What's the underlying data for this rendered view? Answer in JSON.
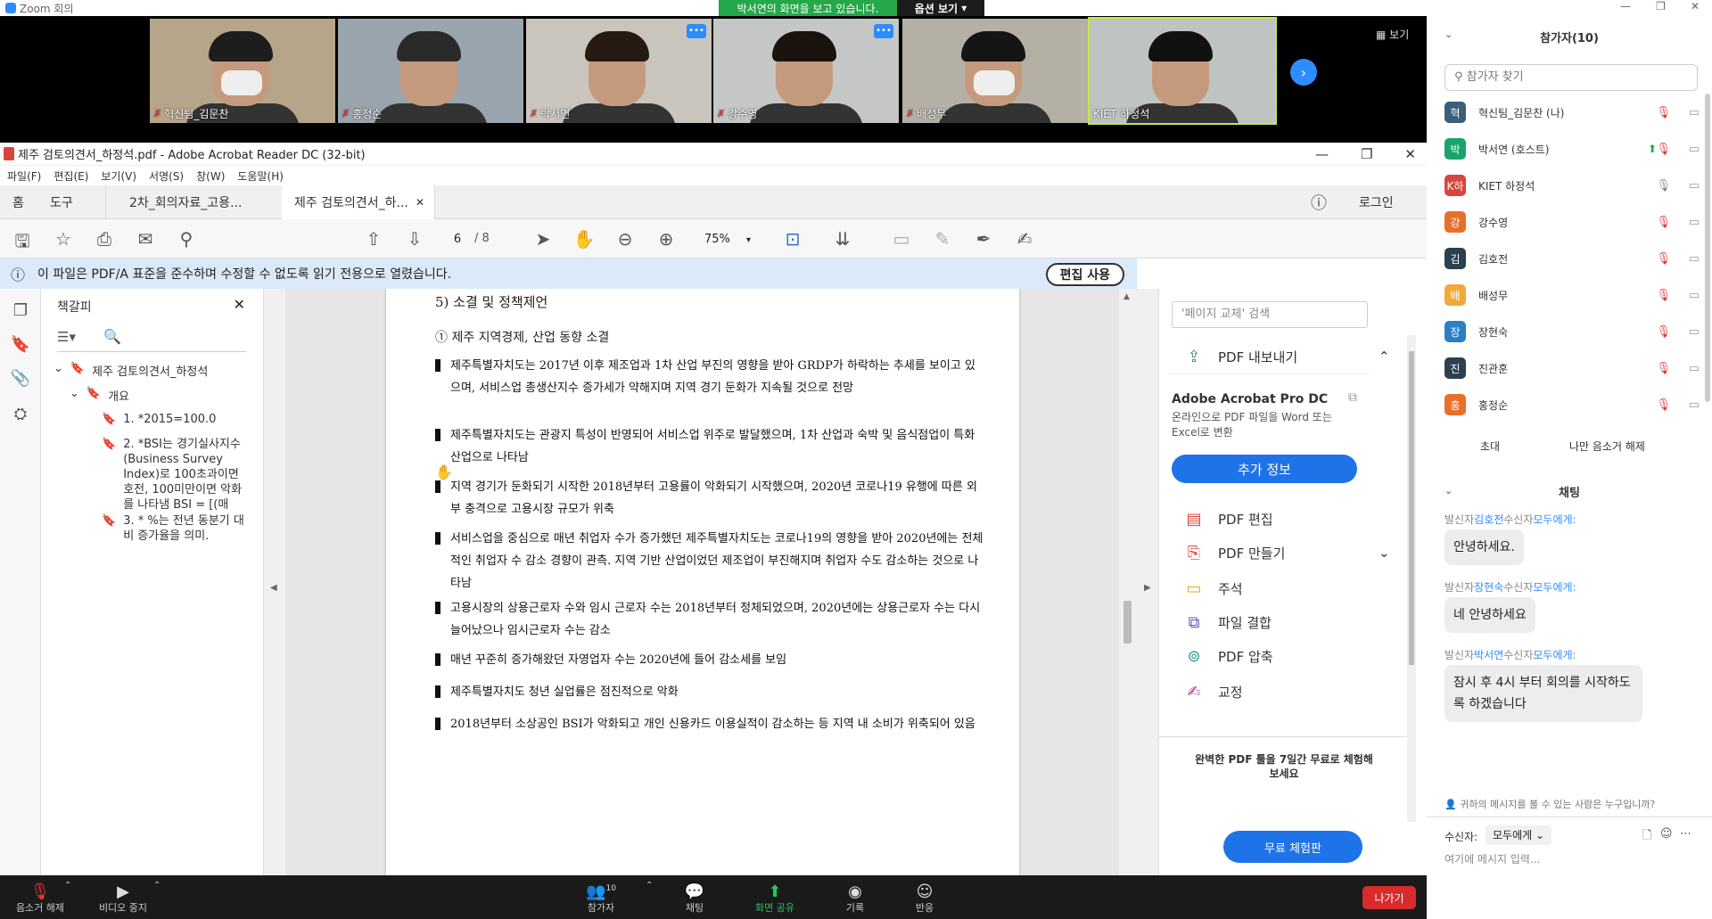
{
  "zoom": {
    "window_title": "Zoom 회의",
    "share_banner": "박서연의 화면을 보고 있습니다.",
    "view_options": "옵션 보기",
    "gallery_view": "보기",
    "tiles": [
      {
        "name": "혁신팀_김문찬",
        "muted": true,
        "mask": true,
        "hair": "#1d1d1d",
        "bg": "#b7a58a"
      },
      {
        "name": "홍정순",
        "muted": true,
        "mask": false,
        "hair": "#2a2a2a",
        "bg": "#9aa4ad"
      },
      {
        "name": "박서연",
        "muted": true,
        "mask": false,
        "hair": "#241a12",
        "bg": "#c9c5bd",
        "more": true
      },
      {
        "name": "강수영",
        "muted": true,
        "mask": false,
        "hair": "#1a120c",
        "bg": "#c4c7c6",
        "more": true
      },
      {
        "name": "배성무",
        "muted": true,
        "mask": true,
        "hair": "#151515",
        "bg": "#b5b0a6"
      },
      {
        "name": "KIET 하정석",
        "muted": false,
        "mask": false,
        "hair": "#111",
        "bg": "#bfc3c2",
        "active": true
      }
    ],
    "bottom_bar": {
      "mute": "음소거 해제",
      "video": "비디오 중지",
      "participants": "참가자",
      "participant_count": "10",
      "chat": "채팅",
      "share": "화면 공유",
      "record": "기록",
      "reactions": "반응",
      "leave": "나가기"
    },
    "participants_panel": {
      "title": "참가자(10)",
      "search_placeholder": "참가자 찾기",
      "list": [
        {
          "initial": "혁",
          "name": "혁신팀_김문찬 (나)",
          "color": "#3b5f7a",
          "mic": "muted"
        },
        {
          "initial": "박",
          "name": "박서연 (호스트)",
          "color": "#1aa36f",
          "mic": "muted",
          "sharing": true
        },
        {
          "initial": "K하",
          "name": "KIET 하정석",
          "color": "#d9453b",
          "mic": "on"
        },
        {
          "initial": "강",
          "name": "강수영",
          "color": "#e8702a",
          "mic": "muted"
        },
        {
          "initial": "김",
          "name": "김호전",
          "color": "#2c4150",
          "mic": "muted"
        },
        {
          "initial": "배",
          "name": "배성무",
          "color": "#f2a93b",
          "mic": "muted"
        },
        {
          "initial": "장",
          "name": "장현숙",
          "color": "#2b80c5",
          "mic": "muted"
        },
        {
          "initial": "진",
          "name": "진관훈",
          "color": "#2c4150",
          "mic": "muted"
        },
        {
          "initial": "홍",
          "name": "홍정순",
          "color": "#e8702a",
          "mic": "muted"
        }
      ],
      "invite": "초대",
      "unmute_me": "나만 음소거 해제"
    },
    "chat_panel": {
      "title": "채팅",
      "messages": [
        {
          "from": "김호전",
          "to": "모두에게:",
          "text": "안녕하세요."
        },
        {
          "from": "장현숙",
          "to": "모두에게:",
          "text": "네 안녕하세요"
        },
        {
          "from": "박서연",
          "to": "모두에게:",
          "text": "잠시 후 4시 부터 회의를 시작하도록 하겠습니다"
        }
      ],
      "from_label": "발신자",
      "to_label": "수신자",
      "who_can_see": "귀하의 메시지를 볼 수 있는 사람은 누구입니까?",
      "recipient_label": "수신자:",
      "recipient_value": "모두에게",
      "input_placeholder": "여기에 메시지 입력..."
    }
  },
  "acrobat": {
    "title": "제주 검토의견서_하정석.pdf - Adobe Acrobat Reader DC (32-bit)",
    "menu": [
      "파일(F)",
      "편집(E)",
      "보기(V)",
      "서명(S)",
      "창(W)",
      "도움말(H)"
    ],
    "tabs": {
      "home": "홈",
      "tools": "도구",
      "doc1": "2차_회의자료_고용...",
      "doc2": "제주 검토의견서_하...",
      "signin": "로그인"
    },
    "toolbar": {
      "page_current": "6",
      "page_total": "/ 8",
      "zoom": "75%"
    },
    "info_message": "이 파일은 PDF/A 표준을 준수하며 수정할 수 없도록 읽기 전용으로 열렸습니다.",
    "enable_editing": "편집 사용",
    "bookmarks": {
      "title": "책갈피",
      "root": "제주 검토의견서_하정석",
      "overview": "개요",
      "items": [
        "1. *2015=100.0",
        "2. *BSI는 경기실사지수(Business Survey Index)로 100초과이면 호전, 100미만이면 악화를 나타냄 BSI = [(매",
        "3. * %는 전년 동분기 대비 증가율을 의미."
      ]
    },
    "page": {
      "heading": "5) 소결 및 정책제언",
      "subheading": "① 제주 지역경제, 산업 동향 소결",
      "bullets": [
        "제주특별자치도는 2017년 이후 제조업과 1차 산업 부진의 영향을 받아 GRDP가 하락하는 추세를 보이고 있으며, 서비스업 총생산지수 증가세가 약해지며 지역 경기 둔화가 지속될 것으로 전망",
        "제주특별자치도는 관광지 특성이 반영되어 서비스업 위주로 발달했으며, 1차 산업과 숙박 및 음식점업이 특화산업으로 나타남",
        "지역 경기가 둔화되기 시작한 2018년부터 고용률이 악화되기 시작했으며, 2020년 코로나19 유행에 따른 외부 충격으로 고용시장 규모가 위축",
        "서비스업을 중심으로 매년 취업자 수가 증가했던 제주특별자치도는 코로나19의 영향을 받아 2020년에는 전체적인 취업자 수 감소 경향이 관측. 지역 기반 산업이었던 제조업이 부진해지며 취업자 수도 감소하는 것으로 나타남",
        "고용시장의 상용근로자 수와 임시 근로자 수는 2018년부터 정체되었으며, 2020년에는 상용근로자 수는 다시 늘어났으나 임시근로자 수는 감소",
        "매년 꾸준히 증가해왔던 자영업자 수는 2020년에 들어 감소세를 보임",
        "제주특별자치도 청년 실업률은 점진적으로 악화",
        "2018년부터 소상공인 BSI가 악화되고 개인 신용카드 이용실적이 감소하는 등 지역 내 소비가 위축되어 있음"
      ]
    },
    "right_pane": {
      "search_placeholder": "'페이지 교체' 검색",
      "export_pdf": "PDF 내보내기",
      "product": "Adobe Acrobat Pro DC",
      "product_desc": "온라인으로 PDF 파일을 Word 또는 Excel로 변환",
      "more_info": "추가 정보",
      "tools": [
        "PDF 편집",
        "PDF 만들기",
        "주석",
        "파일 결합",
        "PDF 압축",
        "교정"
      ],
      "promo": "완벽한 PDF 툴을 7일간 무료로 체험해 보세요",
      "trial": "무료 체험판"
    }
  }
}
